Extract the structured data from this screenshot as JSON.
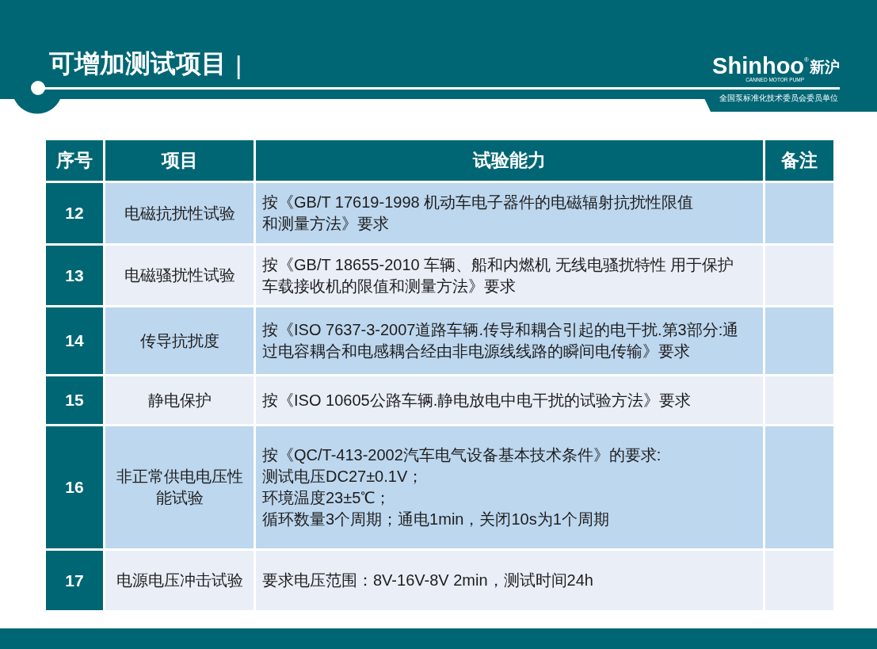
{
  "header": {
    "title": "可增加测试项目",
    "separator": "|",
    "logo": {
      "wordmark": "Shinhoo",
      "registered_mark": "®",
      "chinese_name": "新沪",
      "tagline": "CANNED MOTOR PUMP"
    },
    "membership": "全国泵标准化技术委员会委员单位"
  },
  "table": {
    "columns": [
      "序号",
      "项目",
      "试验能力",
      "备注"
    ],
    "rows": [
      {
        "number": "12",
        "item": "电磁抗扰性试验",
        "requirement": [
          "按《GB/T 17619-1998 机动车电子器件的电磁辐射抗扰性限值",
          "和测量方法》要求"
        ]
      },
      {
        "number": "13",
        "item": "电磁骚扰性试验",
        "requirement": [
          "按《GB/T 18655-2010 车辆、船和内燃机 无线电骚扰特性 用于保护",
          "车载接收机的限值和测量方法》要求"
        ]
      },
      {
        "number": "14",
        "item": "传导抗扰度",
        "requirement": [
          "按《ISO 7637-3-2007道路车辆.传导和耦合引起的电干扰.第3部分:通",
          "过电容耦合和电感耦合经由非电源线线路的瞬间电传输》要求"
        ]
      },
      {
        "number": "15",
        "item": "静电保护",
        "requirement": [
          "按《ISO 10605公路车辆.静电放电中电干扰的试验方法》要求"
        ]
      },
      {
        "number": "16",
        "item": "非正常供电电压性能试验",
        "requirement": [
          "按《QC/T-413-2002汽车电气设备基本技术条件》的要求:",
          "测试电压DC27±0.1V；",
          "环境温度23±5℃；",
          "循环数量3个周期；通电1min，关闭10s为1个周期"
        ]
      },
      {
        "number": "17",
        "item": "电源电压冲击试验",
        "requirement": [
          "要求电压范围：8V-16V-8V 2min，测试时间24h"
        ]
      }
    ]
  }
}
